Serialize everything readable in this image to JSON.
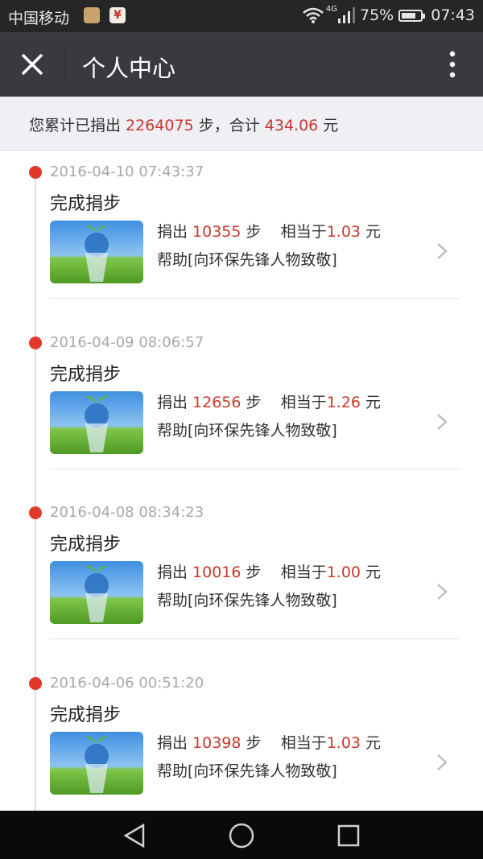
{
  "status_bar": {
    "carrier": "中国移动",
    "network": "4G",
    "battery": "75%",
    "battery_level": 0.75,
    "time": "07:43"
  },
  "header": {
    "title": "个人中心"
  },
  "summary": {
    "prefix": "您累计已捐出 ",
    "steps": "2264075",
    "mid": " 步，合计 ",
    "amount": "434.06",
    "suffix": " 元"
  },
  "entries": [
    {
      "timestamp": "2016-04-10 07:43:37",
      "status": "完成捐步",
      "donated_label": "捐出 ",
      "steps": "10355",
      "steps_suffix": " 步    相当于",
      "amount": "1.03",
      "amount_suffix": " 元",
      "project": "帮助[向环保先锋人物致敬]"
    },
    {
      "timestamp": "2016-04-09 08:06:57",
      "status": "完成捐步",
      "donated_label": "捐出 ",
      "steps": "12656",
      "steps_suffix": " 步    相当于",
      "amount": "1.26",
      "amount_suffix": " 元",
      "project": "帮助[向环保先锋人物致敬]"
    },
    {
      "timestamp": "2016-04-08 08:34:23",
      "status": "完成捐步",
      "donated_label": "捐出 ",
      "steps": "10016",
      "steps_suffix": " 步    相当于",
      "amount": "1.00",
      "amount_suffix": " 元",
      "project": "帮助[向环保先锋人物致敬]"
    },
    {
      "timestamp": "2016-04-06 00:51:20",
      "status": "完成捐步",
      "donated_label": "捐出 ",
      "steps": "10398",
      "steps_suffix": " 步    相当于",
      "amount": "1.03",
      "amount_suffix": " 元",
      "project": "帮助[向环保先锋人物致敬]"
    }
  ],
  "colors": {
    "accent_red": "#c8372d",
    "dot_red": "#e0382b",
    "header_bg": "#393a3f"
  },
  "icons": {
    "close": "close-icon",
    "more": "more-vertical-icon",
    "chevron": "chevron-right-icon",
    "back": "back-triangle-icon",
    "home": "home-circle-icon",
    "recents": "recents-square-icon"
  }
}
